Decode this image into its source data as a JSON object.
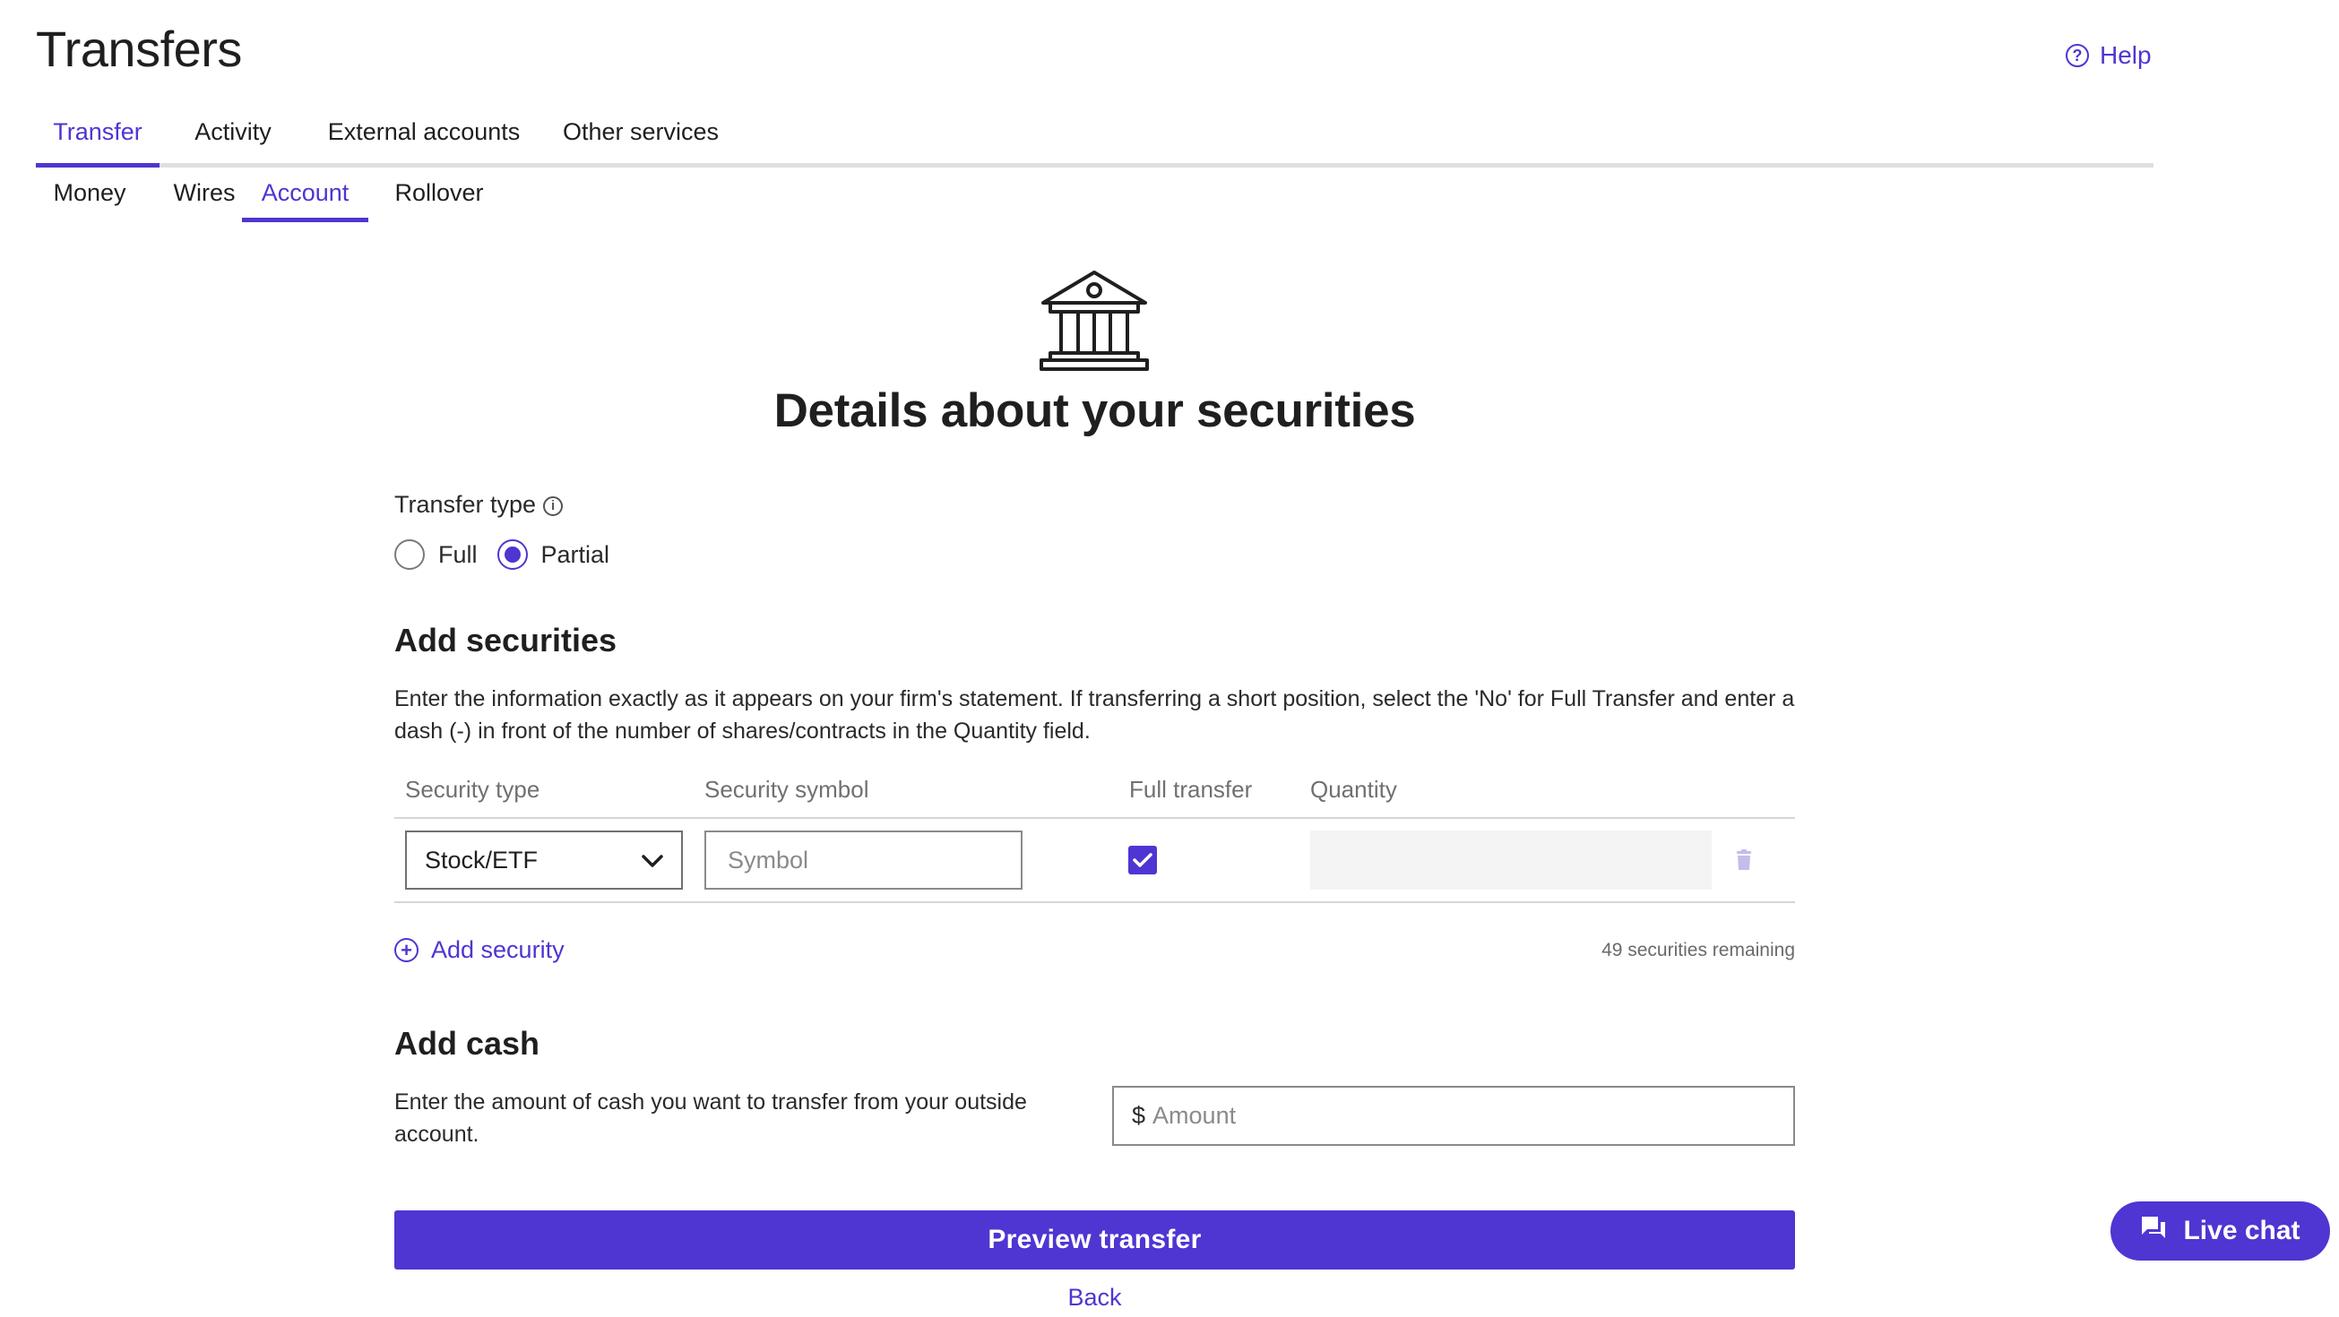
{
  "header": {
    "title": "Transfers",
    "help_label": "Help"
  },
  "tabs_primary": [
    {
      "label": "Transfer",
      "active": true
    },
    {
      "label": "Activity",
      "active": false
    },
    {
      "label": "External accounts",
      "active": false
    },
    {
      "label": "Other services",
      "active": false
    }
  ],
  "tabs_secondary": [
    {
      "label": "Money",
      "active": false
    },
    {
      "label": "Wires",
      "active": false
    },
    {
      "label": "Account",
      "active": true
    },
    {
      "label": "Rollover",
      "active": false
    }
  ],
  "main": {
    "heading": "Details about your securities",
    "icon": "bank-building-icon"
  },
  "transfer_type": {
    "label": "Transfer type",
    "options": [
      "Full",
      "Partial"
    ],
    "selected": "Partial"
  },
  "add_securities": {
    "heading": "Add securities",
    "description": "Enter the information exactly as it appears on your firm's statement. If transferring a short position, select the 'No' for Full Transfer and enter a dash (-) in front of the number of shares/contracts in the Quantity field.",
    "columns": [
      "Security type",
      "Security symbol",
      "Full transfer",
      "Quantity"
    ],
    "rows": [
      {
        "security_type": "Stock/ETF",
        "symbol_value": "",
        "symbol_placeholder": "Symbol",
        "full_transfer": true,
        "quantity": ""
      }
    ],
    "add_label": "Add security",
    "remaining": "49 securities remaining"
  },
  "add_cash": {
    "heading": "Add cash",
    "description": "Enter the amount of cash you want to transfer from your outside account.",
    "currency_symbol": "$",
    "amount_placeholder": "Amount"
  },
  "actions": {
    "preview_label": "Preview transfer",
    "back_label": "Back"
  },
  "live_chat": {
    "label": "Live chat"
  },
  "colors": {
    "accent": "#4f35d2",
    "text": "#1f1f1f",
    "muted": "#707070",
    "divider": "#d6d6d6"
  }
}
